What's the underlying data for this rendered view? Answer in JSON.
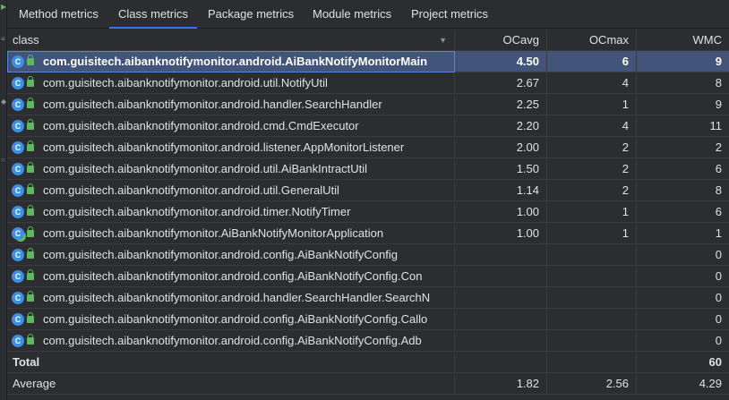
{
  "tabs": [
    {
      "label": "Method metrics",
      "active": false
    },
    {
      "label": "Class metrics",
      "active": true
    },
    {
      "label": "Package metrics",
      "active": false
    },
    {
      "label": "Module metrics",
      "active": false
    },
    {
      "label": "Project metrics",
      "active": false
    }
  ],
  "table": {
    "columns": [
      "class",
      "OCavg",
      "OCmax",
      "WMC"
    ],
    "rows": [
      {
        "name": "com.guisitech.aibanknotifymonitor.android.AiBankNotifyMonitorMain",
        "ocavg": "4.50",
        "ocmax": "6",
        "wmc": "9"
      },
      {
        "name": "com.guisitech.aibanknotifymonitor.android.util.NotifyUtil",
        "ocavg": "2.67",
        "ocmax": "4",
        "wmc": "8"
      },
      {
        "name": "com.guisitech.aibanknotifymonitor.android.handler.SearchHandler",
        "ocavg": "2.25",
        "ocmax": "1",
        "wmc": "9"
      },
      {
        "name": "com.guisitech.aibanknotifymonitor.android.cmd.CmdExecutor",
        "ocavg": "2.20",
        "ocmax": "4",
        "wmc": "11"
      },
      {
        "name": "com.guisitech.aibanknotifymonitor.android.listener.AppMonitorListener",
        "ocavg": "2.00",
        "ocmax": "2",
        "wmc": "2"
      },
      {
        "name": "com.guisitech.aibanknotifymonitor.android.util.AiBankIntractUtil",
        "ocavg": "1.50",
        "ocmax": "2",
        "wmc": "6"
      },
      {
        "name": "com.guisitech.aibanknotifymonitor.android.util.GeneralUtil",
        "ocavg": "1.14",
        "ocmax": "2",
        "wmc": "8"
      },
      {
        "name": "com.guisitech.aibanknotifymonitor.android.timer.NotifyTimer",
        "ocavg": "1.00",
        "ocmax": "1",
        "wmc": "6"
      },
      {
        "name": "com.guisitech.aibanknotifymonitor.AiBankNotifyMonitorApplication",
        "ocavg": "1.00",
        "ocmax": "1",
        "wmc": "1"
      },
      {
        "name": "com.guisitech.aibanknotifymonitor.android.config.AiBankNotifyConfig",
        "ocavg": "",
        "ocmax": "",
        "wmc": "0"
      },
      {
        "name": "com.guisitech.aibanknotifymonitor.android.config.AiBankNotifyConfig.Con",
        "ocavg": "",
        "ocmax": "",
        "wmc": "0"
      },
      {
        "name": "com.guisitech.aibanknotifymonitor.android.handler.SearchHandler.SearchN",
        "ocavg": "",
        "ocmax": "",
        "wmc": "0"
      },
      {
        "name": "com.guisitech.aibanknotifymonitor.android.config.AiBankNotifyConfig.Callo",
        "ocavg": "",
        "ocmax": "",
        "wmc": "0"
      },
      {
        "name": "com.guisitech.aibanknotifymonitor.android.config.AiBankNotifyConfig.Adb",
        "ocavg": "",
        "ocmax": "",
        "wmc": "0"
      }
    ],
    "total": {
      "label": "Total",
      "ocavg": "",
      "ocmax": "",
      "wmc": "60"
    },
    "average": {
      "label": "Average",
      "ocavg": "1.82",
      "ocmax": "2.56",
      "wmc": "4.29"
    }
  },
  "icons": {
    "class": "class-icon",
    "access": "lock-icon",
    "sort": "sort-descending-icon"
  },
  "colors": {
    "accent": "#3574f0",
    "selection": "#43547a",
    "class_icon": "#3d8fe0",
    "access_icon": "#5fb85f"
  }
}
